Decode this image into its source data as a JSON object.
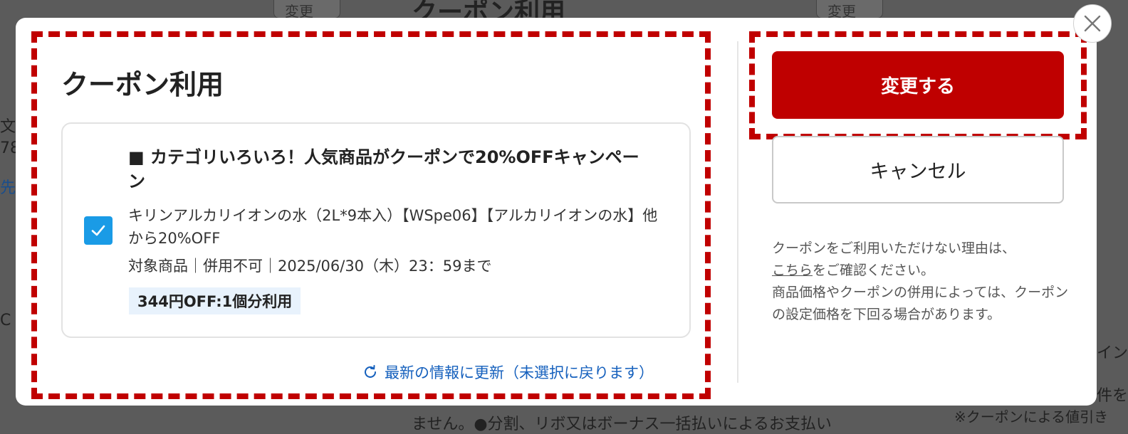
{
  "background": {
    "top_title": "クーポン利用",
    "top_button_left": "変更",
    "top_button_right": "変更",
    "bottom_text": "ません。●分割、リボ又はボーナス一括払いによるお支払い",
    "bottom_right_text": "※クーポンによる値引き",
    "left_text": [
      "文王",
      "78",
      "先",
      "C"
    ],
    "right_text": [
      "イン",
      "件を"
    ]
  },
  "modal": {
    "title": "クーポン利用",
    "close_icon": "close-icon",
    "coupon": {
      "title": "■ カテゴリいろいろ！人気商品がクーポンで20%OFFキャンペーン",
      "checked": true,
      "description": "キリンアルカリイオンの水（2L*9本入）【WSpe06】【アルカリイオンの水】他から20%OFF",
      "meta": "対象商品｜併用不可｜2025/06/30（木）23：59まで",
      "badge": "344円OFF:1個分利用"
    },
    "refresh_label": "最新の情報に更新（未選択に戻ります）",
    "apply_button": "変更する",
    "cancel_button": "キャンセル",
    "note": {
      "line1": "クーポンをご利用いただけない理由は、",
      "link": "こちら",
      "line2_suffix": "をご確認ください。",
      "line3": "商品価格やクーポンの併用によっては、クーポンの設定価格を下回る場合があります。"
    }
  },
  "colors": {
    "accent_red": "#bf0000",
    "checkbox_blue": "#1a9be6",
    "link_blue": "#1560bd",
    "badge_bg": "#e8f2fc"
  }
}
